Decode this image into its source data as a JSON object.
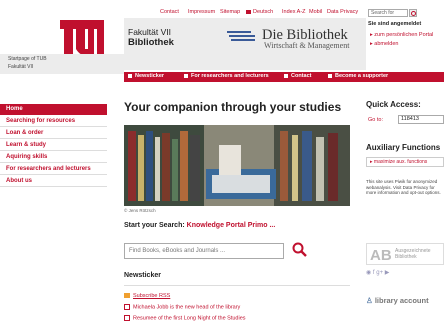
{
  "topnav": {
    "contact": "Contact",
    "impressum": "Impressum",
    "sitemap": "Sitemap",
    "deutsch": "Deutsch",
    "index": "Index A-Z",
    "mobil": "Mobil",
    "privacy": "Data Privacy",
    "search_placeholder": "Search for"
  },
  "breadcrumbs": [
    "Startpage of TUB",
    "Fakultät VII"
  ],
  "header": {
    "faculty_line1": "Fakultät VII",
    "faculty_line2": "Bibliothek",
    "library_name": "Die Bibliothek",
    "library_sub": "Wirtschaft & Management"
  },
  "login": {
    "title": "Sie sind angemeldet",
    "link1": "zum persönlichen Portal",
    "link2": "abmelden"
  },
  "navbar": [
    "Newsticker",
    "For researchers and lecturers",
    "Contact",
    "Become a supporter"
  ],
  "sidebar": [
    "Home",
    "Searching for resources",
    "Loan & order",
    "Learn & study",
    "Aquiring skills",
    "For researchers and lecturers",
    "About us"
  ],
  "main": {
    "title": "Your companion through your studies",
    "photo_credit": "© Jens Rötzsch",
    "search_prefix": "Start your Search:",
    "search_link": "Knowledge Portal Primo ...",
    "find_placeholder": "Find Books, eBooks and Journals ...",
    "newsticker_title": "Newsticker",
    "news": [
      "Subscribe RSS",
      "Michaela Jobb is the new head of the library",
      "Resumee of the first Long Night of the Studies"
    ]
  },
  "right": {
    "quick_access": "Quick Access:",
    "goto_label": "Go to:",
    "goto_value": "118413",
    "aux_title": "Auxiliary Functions",
    "aux_button": "maximize aux. functions",
    "piwik_text": "This site uses Piwik for anonymized webanalysis. Visit Data Privacy for more information and opt-out options.",
    "ab_text": "Ausgezeichnete Bibliothek",
    "library_account": "library account"
  },
  "colors": {
    "accent": "#c0102e",
    "band": "#ececec"
  }
}
